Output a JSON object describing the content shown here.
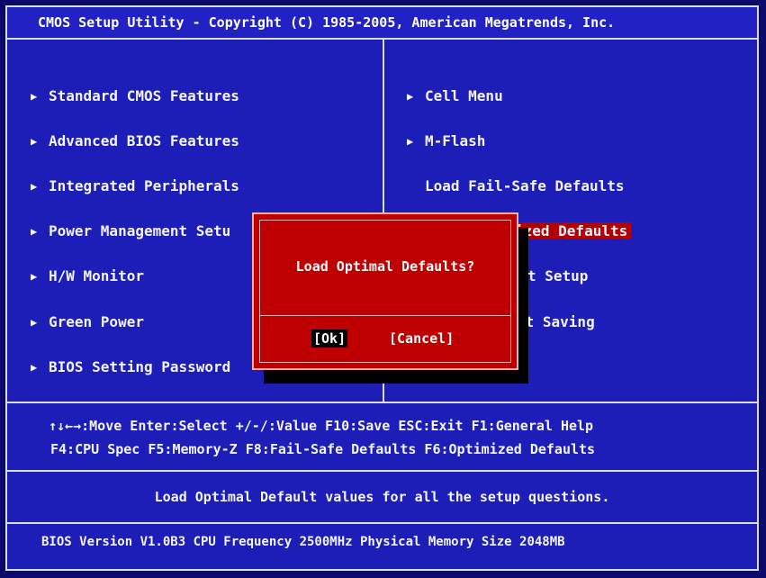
{
  "title": "CMOS Setup Utility - Copyright (C) 1985-2005, American Megatrends, Inc.",
  "left_menu": [
    {
      "label": "Standard CMOS Features",
      "has_arrow": true
    },
    {
      "label": "Advanced BIOS Features",
      "has_arrow": true
    },
    {
      "label": "Integrated Peripherals",
      "has_arrow": true
    },
    {
      "label": "Power Management Setu",
      "has_arrow": true
    },
    {
      "label": "H/W Monitor",
      "has_arrow": true
    },
    {
      "label": "Green Power",
      "has_arrow": true
    },
    {
      "label": "BIOS Setting Password",
      "has_arrow": true
    }
  ],
  "right_menu": [
    {
      "label": "Cell Menu",
      "has_arrow": true
    },
    {
      "label": "M-Flash",
      "has_arrow": true
    },
    {
      "label": "Load Fail-Safe Defaults",
      "has_arrow": false
    },
    {
      "label": "ized Defaults",
      "has_arrow": false,
      "highlighted": true
    },
    {
      "label": "t Setup",
      "has_arrow": false
    },
    {
      "label": "ut Saving",
      "has_arrow": false
    }
  ],
  "dialog": {
    "message": "Load Optimal Defaults?",
    "ok_label": "[Ok]",
    "cancel_label": "[Cancel]"
  },
  "help": {
    "line1": "↑↓←→:Move  Enter:Select  +/-/:Value  F10:Save  ESC:Exit  F1:General Help",
    "line2": "F4:CPU Spec  F5:Memory-Z  F8:Fail-Safe Defaults    F6:Optimized Defaults"
  },
  "description": "Load Optimal Default values for all the setup questions.",
  "status": "BIOS Version V1.0B3 CPU Frequency 2500MHz Physical Memory Size 2048MB",
  "colors": {
    "background": "#1d1db8",
    "dialog": "#bf0000",
    "highlight": "#b30000",
    "text": "#ffffff"
  },
  "icons": {
    "menu_arrow": "triangle-right-icon"
  }
}
